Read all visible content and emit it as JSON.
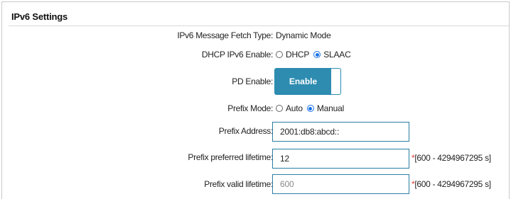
{
  "section": {
    "title": "IPv6 Settings"
  },
  "fetch_type": {
    "label": "IPv6 Message Fetch Type:",
    "value": "Dynamic Mode"
  },
  "dhcp_enable": {
    "label": "DHCP IPv6 Enable:",
    "options": [
      "DHCP",
      "SLAAC"
    ],
    "selected": "SLAAC"
  },
  "pd_enable": {
    "label": "PD Enable:",
    "toggle_label": "Enable",
    "state": "on"
  },
  "prefix_mode": {
    "label": "Prefix Mode:",
    "options": [
      "Auto",
      "Manual"
    ],
    "selected": "Manual"
  },
  "prefix_address": {
    "label": "Prefix Address:",
    "value": "2001:db8:abcd::"
  },
  "preferred_lifetime": {
    "label": "Prefix preferred lifetime:",
    "value": "12",
    "required_mark": "*",
    "range_hint": "[600 - 4294967295 s]"
  },
  "valid_lifetime": {
    "label": "Prefix valid lifetime:",
    "value": "600",
    "required_mark": "*",
    "range_hint": "[600 - 4294967295 s]"
  },
  "colors": {
    "accent": "#2e8cb0",
    "radio_checked": "#1a73e8",
    "required": "#e53935"
  }
}
